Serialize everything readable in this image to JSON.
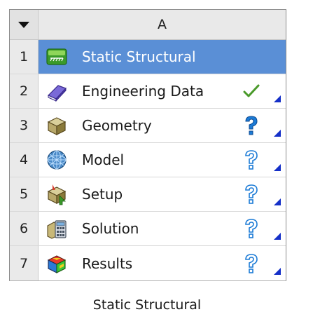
{
  "system": {
    "column_header": "A",
    "caption": "Static Structural",
    "colors": {
      "selected_row": "#5a8fd6",
      "corner_marker": "#1530c8",
      "check": "#4a9a2a",
      "question_solid": "#1c7bd6",
      "question_outline": "#1c7bd6"
    },
    "rows": [
      {
        "num": "1",
        "label": "Static Structural",
        "icon": "static-structural-icon",
        "status": ""
      },
      {
        "num": "2",
        "label": "Engineering Data",
        "icon": "engineering-data-book-icon",
        "status": "check-icon"
      },
      {
        "num": "3",
        "label": "Geometry",
        "icon": "geometry-box-icon",
        "status": "question-solid-icon"
      },
      {
        "num": "4",
        "label": "Model",
        "icon": "model-mesh-icon",
        "status": "question-outline-icon"
      },
      {
        "num": "5",
        "label": "Setup",
        "icon": "setup-icon",
        "status": "question-outline-icon"
      },
      {
        "num": "6",
        "label": "Solution",
        "icon": "solution-calculator-icon",
        "status": "question-outline-icon"
      },
      {
        "num": "7",
        "label": "Results",
        "icon": "results-contour-icon",
        "status": "question-outline-icon"
      }
    ]
  }
}
